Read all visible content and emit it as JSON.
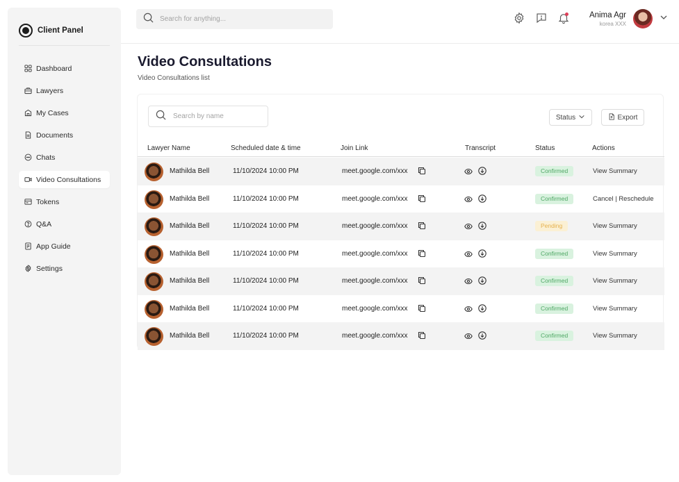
{
  "brand": {
    "name": "Client Panel"
  },
  "nav": [
    {
      "label": "Dashboard",
      "icon": "dashboard-icon"
    },
    {
      "label": "Lawyers",
      "icon": "briefcase-icon"
    },
    {
      "label": "My Cases",
      "icon": "cases-icon"
    },
    {
      "label": "Documents",
      "icon": "document-icon"
    },
    {
      "label": "Chats",
      "icon": "chat-icon"
    },
    {
      "label": "Video Consultations",
      "icon": "video-icon",
      "active": true
    },
    {
      "label": "Tokens",
      "icon": "token-icon"
    },
    {
      "label": "Q&A",
      "icon": "question-icon"
    },
    {
      "label": "App Guide",
      "icon": "guide-icon"
    },
    {
      "label": "Settings",
      "icon": "gear-icon"
    }
  ],
  "topbar": {
    "search_placeholder": "Search for anything...",
    "user_name": "Anima Agr",
    "user_sub": "korea XXX"
  },
  "page": {
    "title": "Video Consultations",
    "subtitle": "Video Consultations list"
  },
  "toolbar": {
    "search_placeholder": "Search by name",
    "status_label": "Status",
    "export_label": "Export"
  },
  "table": {
    "headers": {
      "lawyer": "Lawyer Name",
      "date": "Scheduled date & time",
      "link": "Join Link",
      "transcript": "Transcript",
      "status": "Status",
      "actions": "Actions"
    },
    "rows": [
      {
        "name": "Mathilda Bell",
        "date": "11/10/2024 10:00 PM",
        "link": "meet.google.com/xxx",
        "status": "Confirmed",
        "action": "View Summary"
      },
      {
        "name": "Mathilda Bell",
        "date": "11/10/2024 10:00 PM",
        "link": "meet.google.com/xxx",
        "status": "Confirmed",
        "action": "Cancel | Reschedule"
      },
      {
        "name": "Mathilda Bell",
        "date": "11/10/2024 10:00 PM",
        "link": "meet.google.com/xxx",
        "status": "Pending",
        "action": "View Summary"
      },
      {
        "name": "Mathilda Bell",
        "date": "11/10/2024 10:00 PM",
        "link": "meet.google.com/xxx",
        "status": "Confirmed",
        "action": "View Summary"
      },
      {
        "name": "Mathilda Bell",
        "date": "11/10/2024 10:00 PM",
        "link": "meet.google.com/xxx",
        "status": "Confirmed",
        "action": "View Summary"
      },
      {
        "name": "Mathilda Bell",
        "date": "11/10/2024 10:00 PM",
        "link": "meet.google.com/xxx",
        "status": "Confirmed",
        "action": "View Summary"
      },
      {
        "name": "Mathilda Bell",
        "date": "11/10/2024 10:00 PM",
        "link": "meet.google.com/xxx",
        "status": "Confirmed",
        "action": "View Summary"
      }
    ]
  },
  "colors": {
    "confirmed_bg": "#d9f2df",
    "confirmed_text": "#4ea764",
    "pending_bg": "#fbf0d4",
    "pending_text": "#e5b14d",
    "notification_dot": "#e0405a"
  }
}
